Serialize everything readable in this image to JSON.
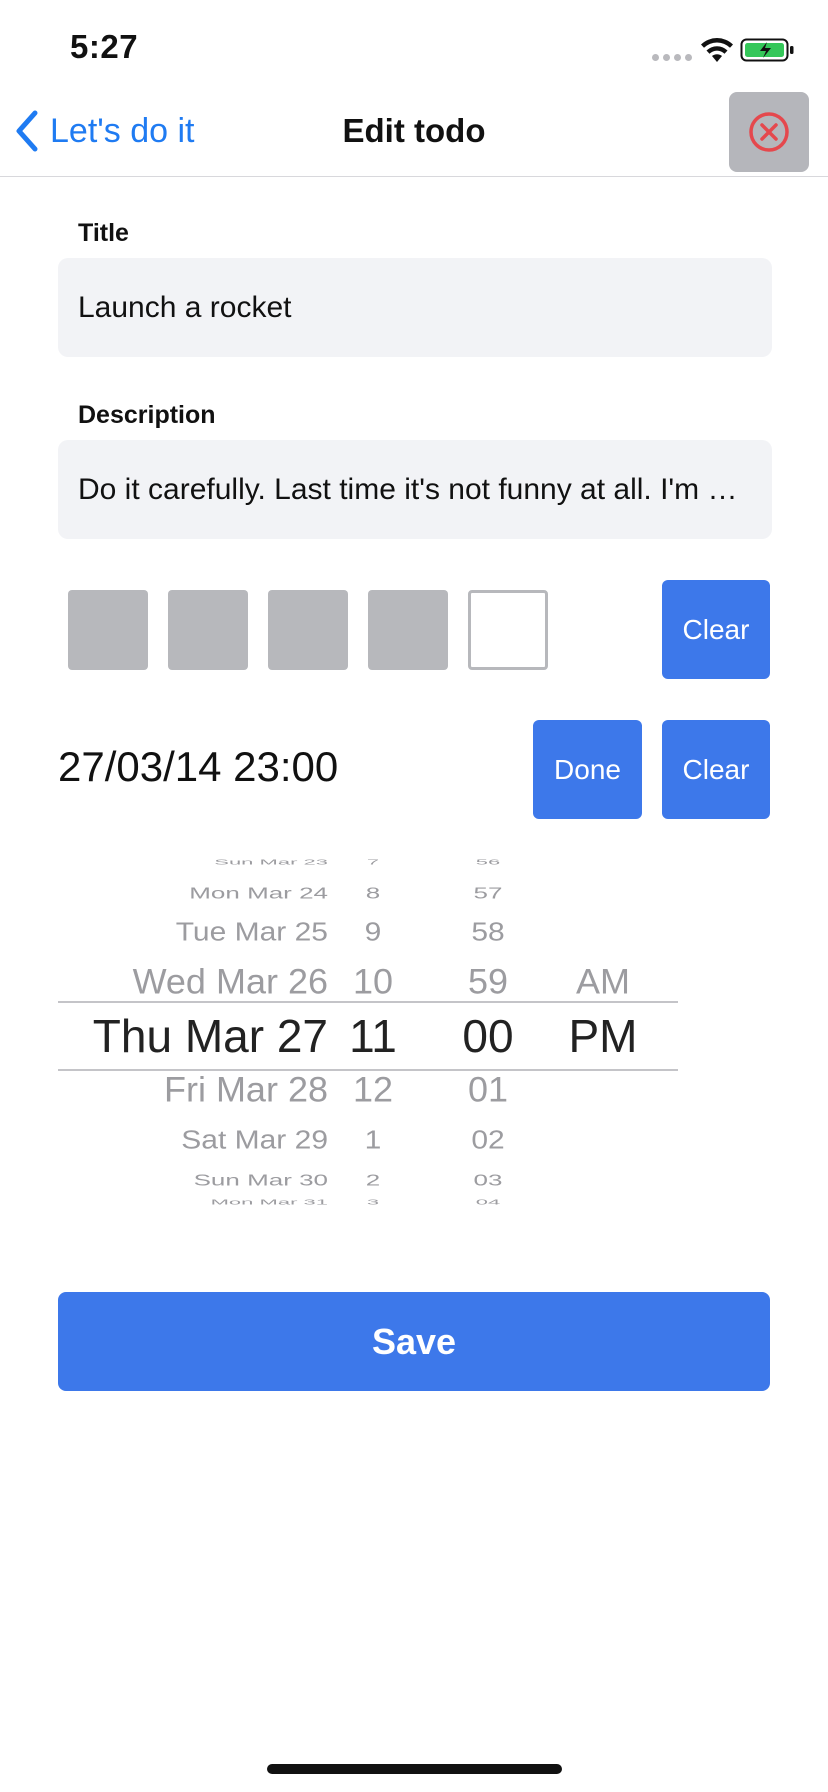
{
  "status_bar": {
    "time": "5:27"
  },
  "nav": {
    "back_label": "Let's do it",
    "title": "Edit todo"
  },
  "form": {
    "title_label": "Title",
    "title_value": "Launch a rocket",
    "description_label": "Description",
    "description_value": "Do it carefully. Last time it's not funny at all. I'm serious.",
    "priority": {
      "filled": 4,
      "total": 5
    },
    "priority_clear_label": "Clear",
    "due_date_value": "27/03/14 23:00",
    "done_label": "Done",
    "date_clear_label": "Clear",
    "save_label": "Save"
  },
  "picker": {
    "dates": [
      "Sun Mar 23",
      "Mon Mar 24",
      "Tue Mar 25",
      "Wed Mar 26",
      "Thu Mar 27",
      "Fri Mar 28",
      "Sat Mar 29",
      "Sun Mar 30",
      "Mon Mar 31"
    ],
    "hours": [
      "7",
      "8",
      "9",
      "10",
      "11",
      "12",
      "1",
      "2",
      "3"
    ],
    "minutes": [
      "56",
      "57",
      "58",
      "59",
      "00",
      "01",
      "02",
      "03",
      "04"
    ],
    "ampm": [
      "",
      "",
      "",
      "AM",
      "PM",
      "",
      "",
      "",
      ""
    ],
    "selected_index": 4
  },
  "colors": {
    "accent": "#3d78ea",
    "link": "#1f7bf2",
    "close_icon": "#e5484d",
    "field_bg": "#f2f3f6",
    "priority_filled": "#b7b8bc"
  },
  "icons": {
    "back": "chevron-left-icon",
    "close": "x-circle-icon",
    "wifi": "wifi-icon",
    "battery": "battery-charging-icon"
  }
}
